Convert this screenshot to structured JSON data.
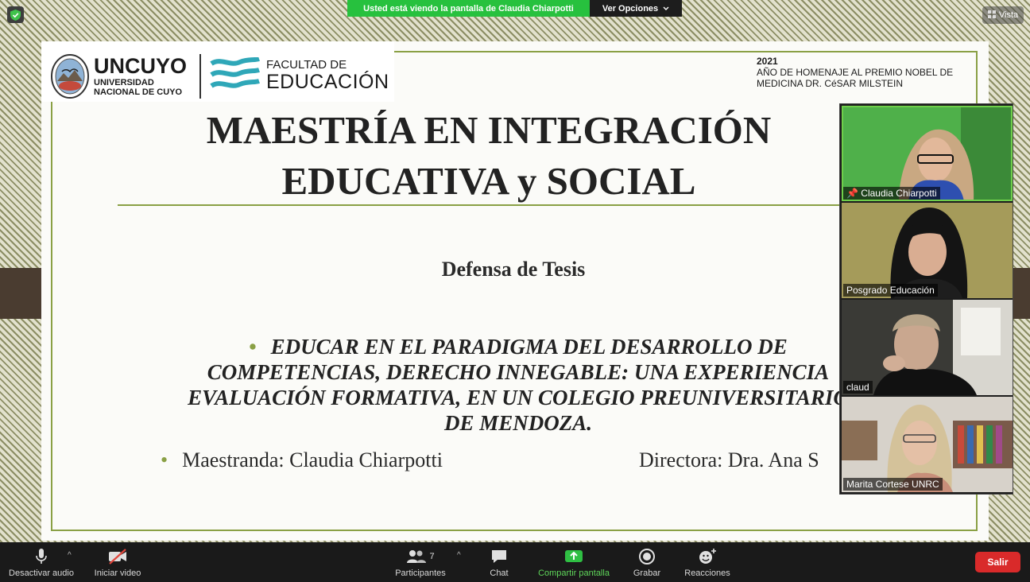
{
  "banner": {
    "message": "Usted está viendo la pantalla de Claudia Chiarpotti",
    "options_label": "Ver Opciones"
  },
  "view_label": "Vista",
  "slide": {
    "logo_uncuyo": "UNCUYO",
    "logo_uncuyo_line1": "UNIVERSIDAD",
    "logo_uncuyo_line2": "NACIONAL DE CUYO",
    "logo_faculty_line1": "FACULTAD DE",
    "logo_faculty_line2": "EDUCACIÓN",
    "year": "2021",
    "homage_line1": "AÑO DE HOMENAJE AL PREMIO NOBEL DE",
    "homage_line2": "MEDICINA DR. CéSAR MILSTEIN",
    "title_line1": "MAESTRÍA EN INTEGRACIÓN",
    "title_line2": "EDUCATIVA y SOCIAL",
    "subtitle": "Defensa de Tesis",
    "thesis_line1": "EDUCAR EN EL PARADIGMA DEL DESARROLLO DE",
    "thesis_line2": "COMPETENCIAS, DERECHO INNEGABLE: UNA EXPERIENCIA",
    "thesis_line3": "EVALUACIÓN FORMATIVA, EN UN COLEGIO PREUNIVERSITARIO",
    "thesis_line4": "DE MENDOZA.",
    "student": "Maestranda: Claudia Chiarpotti",
    "director": "Directora: Dra. Ana S"
  },
  "participants_gallery": [
    {
      "name": "Claudia Chiarpotti",
      "pinned": true
    },
    {
      "name": "Posgrado Educación",
      "pinned": false
    },
    {
      "name": "claud",
      "pinned": false
    },
    {
      "name": "Marita Cortese UNRC",
      "pinned": false
    }
  ],
  "toolbar": {
    "mute_label": "Desactivar audio",
    "video_label": "Iniciar video",
    "participants_label": "Participantes",
    "participants_count": "7",
    "chat_label": "Chat",
    "share_label": "Compartir pantalla",
    "record_label": "Grabar",
    "reactions_label": "Reacciones",
    "exit_label": "Salir"
  },
  "colors": {
    "share_green": "#27c13e",
    "slide_accent": "#8aa045",
    "exit_red": "#d92a2a"
  }
}
